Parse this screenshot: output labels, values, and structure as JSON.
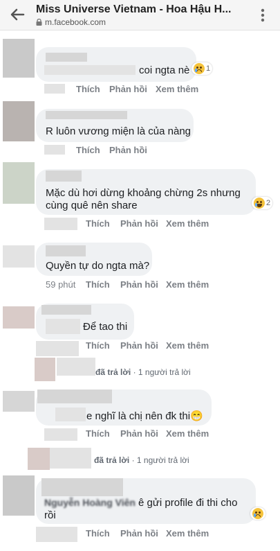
{
  "browser": {
    "title": "Miss Universe Vietnam - Hoa Hậu H...",
    "url": "m.facebook.com",
    "icons": [
      "back-arrow-icon",
      "lock-icon",
      "more-vertical-icon"
    ]
  },
  "actions": {
    "like": "Thích",
    "reply": "Phản hồi",
    "more": "Xem thêm"
  },
  "comments": [
    {
      "text": "coi ngta nè",
      "reaction_count": "1"
    },
    {
      "text": "R luôn vương miện là của nàng"
    },
    {
      "text_line1": "Mặc dù hơi dừng khoảng chừng 2s nhưng",
      "text_line2": "cùng quê nên share",
      "reaction_count": "2"
    },
    {
      "text": "Quyền tự do ngta mà?",
      "time": "59 phút"
    },
    {
      "text": "Để tao thi"
    },
    {
      "reply_summary": "đã trả lời",
      "reply_count": "· 1 người trả lời"
    },
    {
      "text": "e nghĩ là chị nên đk thi😁"
    },
    {
      "reply_summary": "đã trả lời",
      "reply_count": "· 1 người trả lời"
    },
    {
      "mention": "Nguyễn Hoàng Viên",
      "text": "ê gửi profile đi thi cho",
      "text_line2": "rồi"
    }
  ],
  "colors": {
    "bubble": "#eff1f3",
    "meta": "#7b7f85",
    "reaction": "#f5c33b"
  }
}
